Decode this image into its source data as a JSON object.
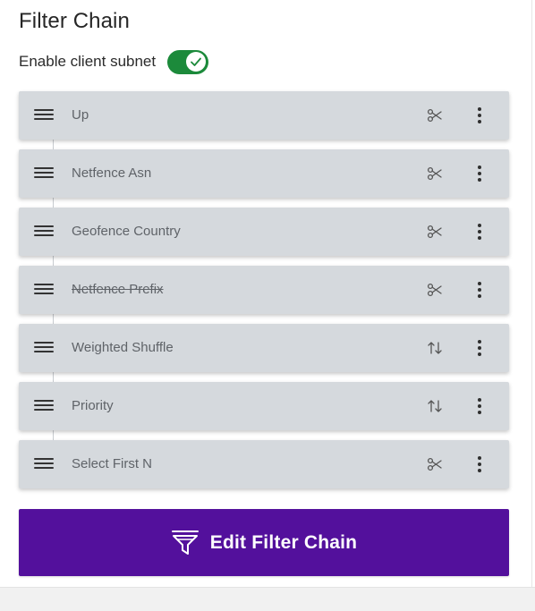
{
  "panel": {
    "title": "Filter Chain",
    "client_subnet": {
      "label": "Enable client subnet",
      "enabled": true,
      "toggle_color": "#1c8a3b"
    },
    "filters": [
      {
        "label": "Up",
        "icon": "scissors-icon",
        "disabled": false
      },
      {
        "label": "Netfence Asn",
        "icon": "scissors-icon",
        "disabled": false
      },
      {
        "label": "Geofence Country",
        "icon": "scissors-icon",
        "disabled": false
      },
      {
        "label": "Netfence Prefix",
        "icon": "scissors-icon",
        "disabled": true
      },
      {
        "label": "Weighted Shuffle",
        "icon": "sort-arrows-icon",
        "disabled": false
      },
      {
        "label": "Priority",
        "icon": "sort-arrows-icon",
        "disabled": false
      },
      {
        "label": "Select First N",
        "icon": "scissors-icon",
        "disabled": false
      }
    ],
    "edit_button": {
      "label": "Edit Filter Chain",
      "icon": "filter-funnel-icon",
      "color": "#53109c"
    }
  }
}
